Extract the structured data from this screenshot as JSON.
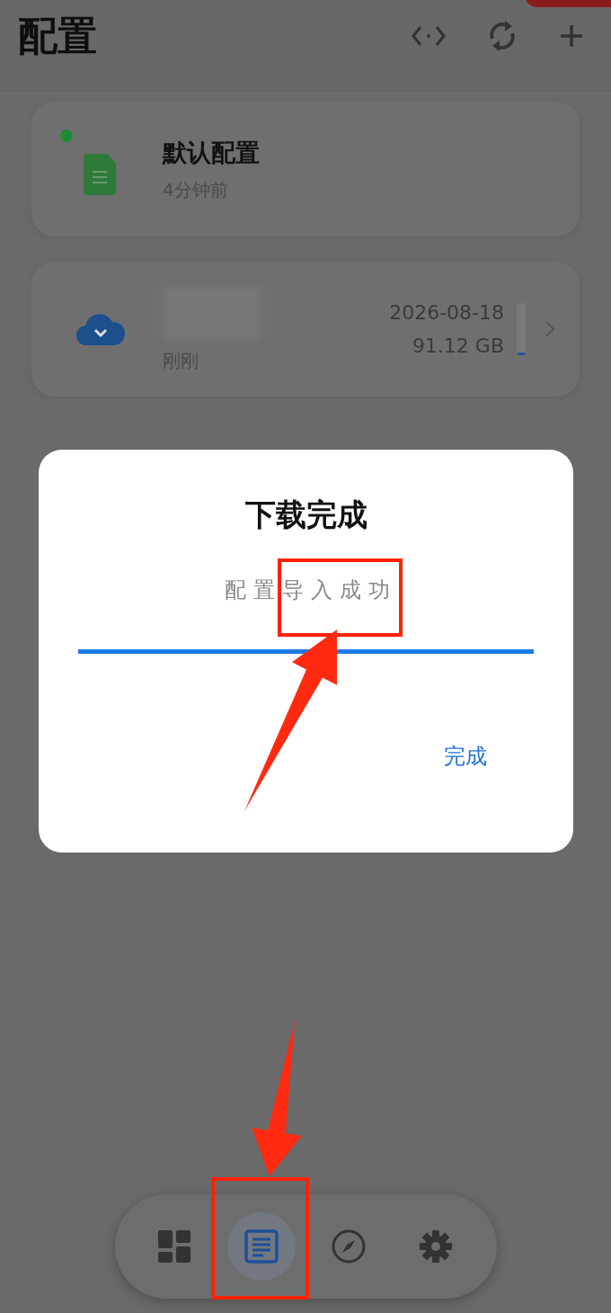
{
  "header": {
    "title": "配置",
    "actions": [
      {
        "kind": "code"
      },
      {
        "kind": "refresh"
      },
      {
        "kind": "add"
      }
    ]
  },
  "profiles": [
    {
      "kind": "local",
      "name": "默认配置",
      "updated": "4分钟前",
      "active": true
    },
    {
      "kind": "remote",
      "updated": "刚刚",
      "expires": "2026-08-18",
      "traffic": "91.12 GB",
      "level": 0.06,
      "active": false
    }
  ],
  "dialog": {
    "title": "下载完成",
    "message": "配置导入成功",
    "level": 1,
    "button": "完成"
  },
  "nav": [
    {
      "kind": "dashboard",
      "selected": false
    },
    {
      "kind": "profiles",
      "selected": true
    },
    {
      "kind": "explore",
      "selected": false
    },
    {
      "kind": "settings",
      "selected": false
    }
  ]
}
